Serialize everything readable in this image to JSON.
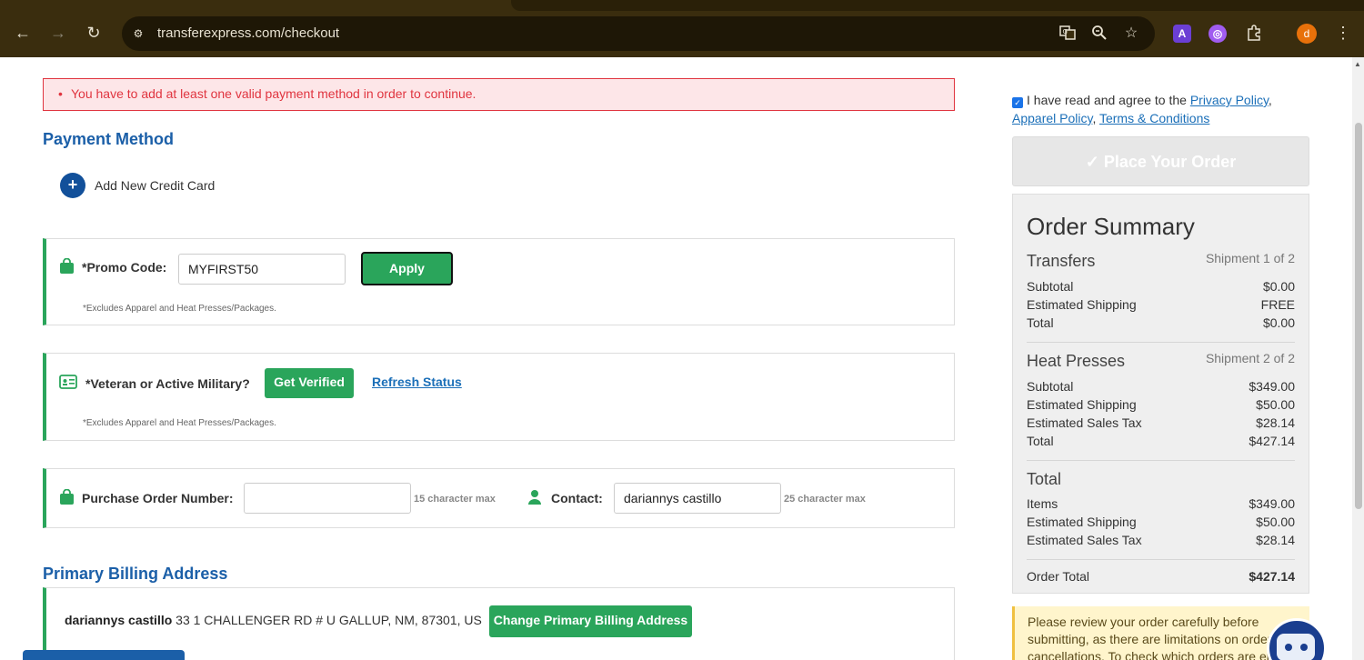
{
  "browser": {
    "url": "transferexpress.com/checkout",
    "nav_back": "←",
    "nav_forward": "→",
    "nav_reload": "↻",
    "profile_initial": "d",
    "menu": "⋮",
    "icons": [
      "translate-icon",
      "zoom-icon",
      "bookmark-star-icon",
      "extension-a-icon",
      "extension-purple-icon",
      "extensions-puzzle-icon"
    ]
  },
  "alert": {
    "bullet": "•",
    "message": "You have to add at least one valid payment method in order to continue."
  },
  "payment": {
    "title": "Payment Method",
    "add_card_label": "Add New Credit Card",
    "add_icon": "+"
  },
  "promo": {
    "label": "*Promo Code:",
    "value": "MYFIRST50",
    "apply_label": "Apply",
    "note": "*Excludes Apparel and Heat Presses/Packages."
  },
  "veteran": {
    "label": "*Veteran or Active Military?",
    "verify_label": "Get Verified",
    "refresh_label": "Refresh Status",
    "note": "*Excludes Apparel and Heat Presses/Packages."
  },
  "po": {
    "label": "Purchase Order Number:",
    "value": "",
    "max_note": "15 character max",
    "contact_label": "Contact:",
    "contact_value": "dariannys castillo",
    "contact_max_note": "25 character max"
  },
  "billing": {
    "title": "Primary Billing Address",
    "name": "dariannys castillo",
    "address": " 33 1 CHALLENGER RD # U GALLUP, NM, 87301, US",
    "change_label": "Change Primary Billing Address"
  },
  "agreement": {
    "prefix": "I have read and agree to the ",
    "privacy": "Privacy Policy",
    "sep1": ",",
    "apparel": "Apparel Policy",
    "sep2": ", ",
    "terms": "Terms & Conditions"
  },
  "place_order": {
    "label": "✓ Place Your Order"
  },
  "summary": {
    "title": "Order Summary",
    "transfers": {
      "heading": "Transfers",
      "shipment": "Shipment 1 of 2",
      "rows": [
        {
          "label": "Subtotal",
          "value": "$0.00"
        },
        {
          "label": "Estimated Shipping",
          "value": "FREE"
        },
        {
          "label": "Total",
          "value": "$0.00"
        }
      ]
    },
    "heat_presses": {
      "heading": "Heat Presses",
      "shipment": "Shipment 2 of 2",
      "rows": [
        {
          "label": "Subtotal",
          "value": "$349.00"
        },
        {
          "label": "Estimated Shipping",
          "value": "$50.00"
        },
        {
          "label": "Estimated Sales Tax",
          "value": "$28.14"
        },
        {
          "label": "Total",
          "value": "$427.14"
        }
      ]
    },
    "total": {
      "heading": "Total",
      "rows": [
        {
          "label": "Items",
          "value": "$349.00"
        },
        {
          "label": "Estimated Shipping",
          "value": "$50.00"
        },
        {
          "label": "Estimated Sales Tax",
          "value": "$28.14"
        }
      ]
    },
    "order_total": {
      "label": "Order Total",
      "value": "$427.14"
    }
  },
  "notice": {
    "text": "Please review your order carefully before submitting, as there are limitations on order cancellations. To check which orders are el"
  },
  "colors": {
    "brand_blue": "#1b5fa8",
    "accent_green": "#2aa55b",
    "error_red": "#e0343f"
  }
}
